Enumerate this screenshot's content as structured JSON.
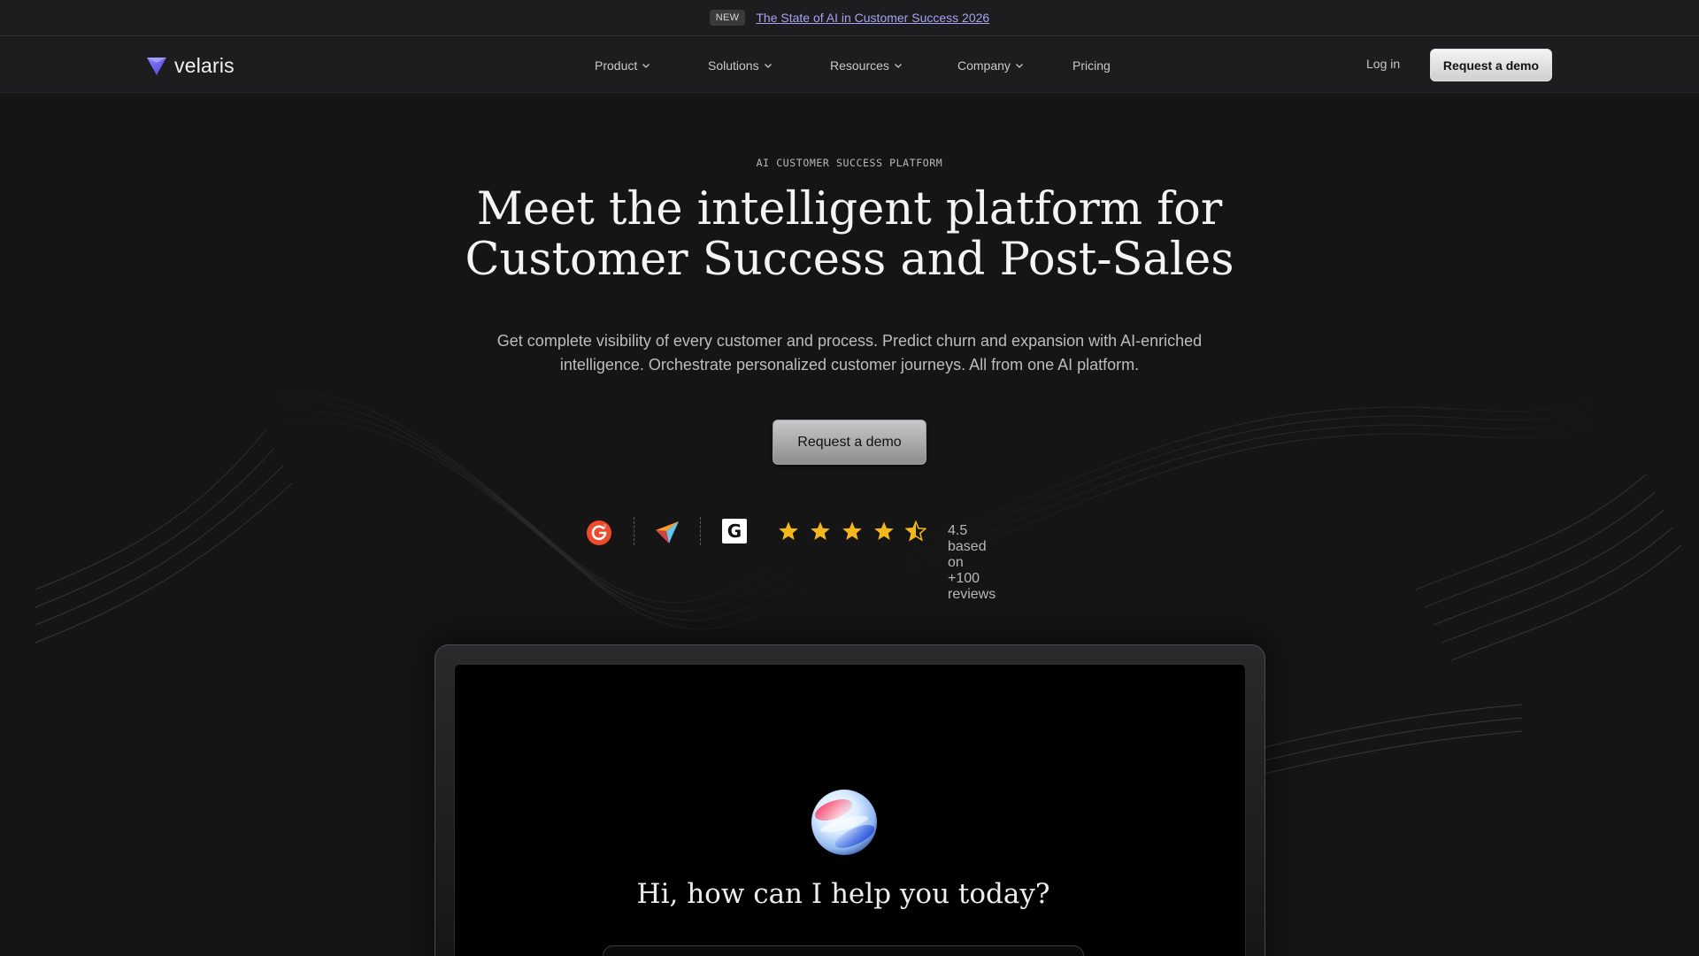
{
  "announcement": {
    "badge": "NEW",
    "link_text": "The State of AI in Customer Success 2026"
  },
  "nav": {
    "brand": "velaris",
    "items": [
      {
        "label": "Product",
        "has_dropdown": true
      },
      {
        "label": "Solutions",
        "has_dropdown": true
      },
      {
        "label": "Resources",
        "has_dropdown": true
      },
      {
        "label": "Company",
        "has_dropdown": true
      },
      {
        "label": "Pricing",
        "has_dropdown": false
      }
    ],
    "login_label": "Log in",
    "cta_label": "Request a demo"
  },
  "hero": {
    "eyebrow": "AI CUSTOMER SUCCESS PLATFORM",
    "headline_line1": "Meet the intelligent platform for",
    "headline_line2": "Customer Success and Post-Sales",
    "subtext": "Get complete visibility of every customer and process. Predict churn and expansion with AI-enriched intelligence. Orchestrate personalized customer journeys. All from one AI platform.",
    "cta_label": "Request a demo"
  },
  "reviews": {
    "platform_icons": [
      "g2-logo-icon",
      "capterra-logo-icon",
      "getapp-logo-icon"
    ],
    "rating": 4.5,
    "max_rating": 5,
    "text": "4.5 based on +100 reviews"
  },
  "device": {
    "greeting": "Hi, how can I help you today?"
  },
  "colors": {
    "background": "#151515",
    "nav_background": "#1d1d1f",
    "link": "#a6a3f2",
    "brand_logo": "#6f64e8",
    "star": "#f5b81c"
  }
}
